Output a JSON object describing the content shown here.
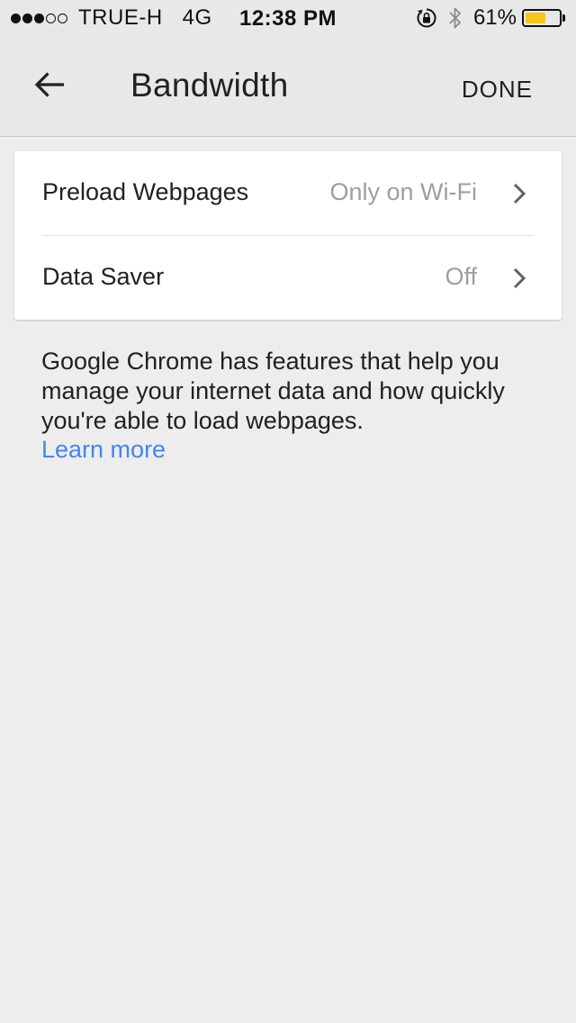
{
  "status_bar": {
    "signal_bars_filled": 3,
    "signal_bars_total": 5,
    "carrier": "TRUE-H",
    "network": "4G",
    "time": "12:38 PM",
    "battery_percent_label": "61%",
    "battery_level": 0.61,
    "icons": [
      "rotation-lock-icon",
      "bluetooth-icon",
      "battery-icon"
    ]
  },
  "toolbar": {
    "back_icon": "arrow-back-icon",
    "title": "Bandwidth",
    "done_label": "DONE"
  },
  "settings": {
    "items": [
      {
        "label": "Preload Webpages",
        "value": "Only on Wi-Fi",
        "icon": "chevron-right-icon"
      },
      {
        "label": "Data Saver",
        "value": "Off",
        "icon": "chevron-right-icon"
      }
    ]
  },
  "description": {
    "text": "Google Chrome has features that help you manage your internet data and how quickly you're able to load webpages.",
    "link_label": "Learn more"
  },
  "colors": {
    "background": "#ededed",
    "toolbar": "#e8e8e8",
    "card": "#ffffff",
    "link": "#4285f4",
    "secondary_text": "#9e9e9e",
    "battery_fill": "#f8c51c"
  }
}
